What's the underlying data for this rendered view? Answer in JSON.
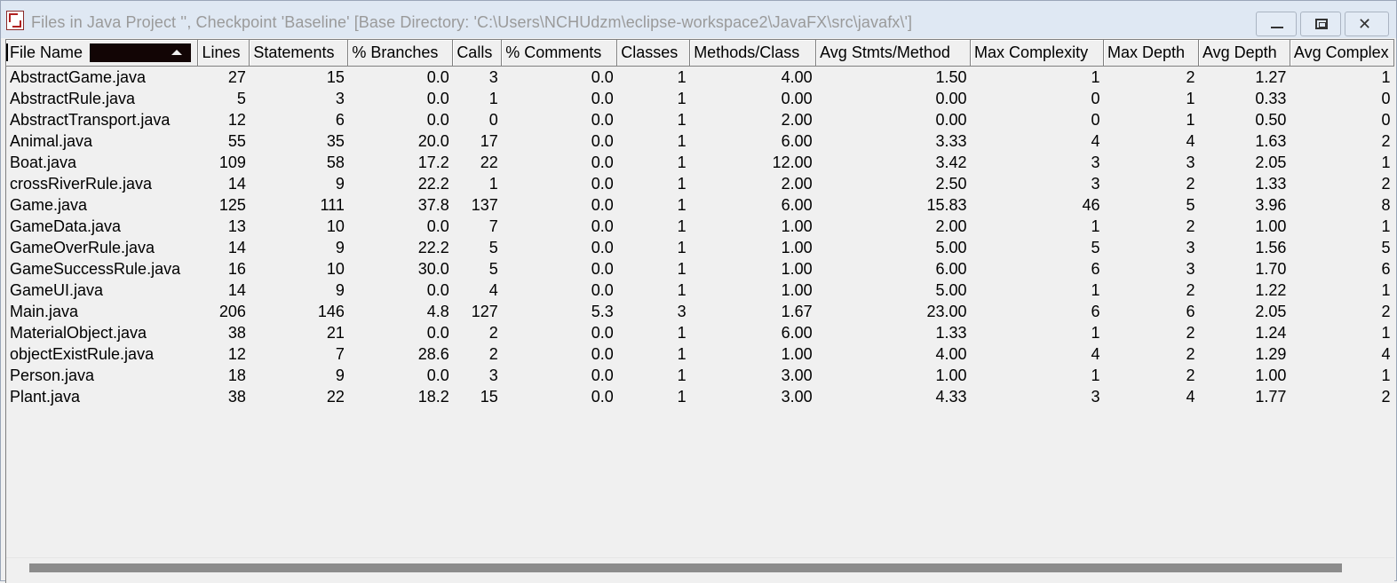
{
  "window": {
    "title": "Files in Java Project '', Checkpoint 'Baseline'  [Base Directory: 'C:\\Users\\NCHUdzm\\eclipse-workspace2\\JavaFX\\src\\javafx\\']",
    "icons": {
      "app": "sourcemonitor-app-icon",
      "minimize": "minimize-icon",
      "maximize": "maximize-icon",
      "close": "close-icon"
    },
    "close_glyph": "✕"
  },
  "table": {
    "sort_indicator": "sort-ascending-icon",
    "columns": [
      "File Name",
      "Lines",
      "Statements",
      "% Branches",
      "Calls",
      "% Comments",
      "Classes",
      "Methods/Class",
      "Avg Stmts/Method",
      "Max Complexity",
      "Max Depth",
      "Avg Depth",
      "Avg Complex"
    ],
    "rows": [
      [
        "AbstractGame.java",
        "27",
        "15",
        "0.0",
        "3",
        "0.0",
        "1",
        "4.00",
        "1.50",
        "1",
        "2",
        "1.27",
        "1"
      ],
      [
        "AbstractRule.java",
        "5",
        "3",
        "0.0",
        "1",
        "0.0",
        "1",
        "0.00",
        "0.00",
        "0",
        "1",
        "0.33",
        "0"
      ],
      [
        "AbstractTransport.java",
        "12",
        "6",
        "0.0",
        "0",
        "0.0",
        "1",
        "2.00",
        "0.00",
        "0",
        "1",
        "0.50",
        "0"
      ],
      [
        "Animal.java",
        "55",
        "35",
        "20.0",
        "17",
        "0.0",
        "1",
        "6.00",
        "3.33",
        "4",
        "4",
        "1.63",
        "2"
      ],
      [
        "Boat.java",
        "109",
        "58",
        "17.2",
        "22",
        "0.0",
        "1",
        "12.00",
        "3.42",
        "3",
        "3",
        "2.05",
        "1"
      ],
      [
        "crossRiverRule.java",
        "14",
        "9",
        "22.2",
        "1",
        "0.0",
        "1",
        "2.00",
        "2.50",
        "3",
        "2",
        "1.33",
        "2"
      ],
      [
        "Game.java",
        "125",
        "111",
        "37.8",
        "137",
        "0.0",
        "1",
        "6.00",
        "15.83",
        "46",
        "5",
        "3.96",
        "8"
      ],
      [
        "GameData.java",
        "13",
        "10",
        "0.0",
        "7",
        "0.0",
        "1",
        "1.00",
        "2.00",
        "1",
        "2",
        "1.00",
        "1"
      ],
      [
        "GameOverRule.java",
        "14",
        "9",
        "22.2",
        "5",
        "0.0",
        "1",
        "1.00",
        "5.00",
        "5",
        "3",
        "1.56",
        "5"
      ],
      [
        "GameSuccessRule.java",
        "16",
        "10",
        "30.0",
        "5",
        "0.0",
        "1",
        "1.00",
        "6.00",
        "6",
        "3",
        "1.70",
        "6"
      ],
      [
        "GameUI.java",
        "14",
        "9",
        "0.0",
        "4",
        "0.0",
        "1",
        "1.00",
        "5.00",
        "1",
        "2",
        "1.22",
        "1"
      ],
      [
        "Main.java",
        "206",
        "146",
        "4.8",
        "127",
        "5.3",
        "3",
        "1.67",
        "23.00",
        "6",
        "6",
        "2.05",
        "2"
      ],
      [
        "MaterialObject.java",
        "38",
        "21",
        "0.0",
        "2",
        "0.0",
        "1",
        "6.00",
        "1.33",
        "1",
        "2",
        "1.24",
        "1"
      ],
      [
        "objectExistRule.java",
        "12",
        "7",
        "28.6",
        "2",
        "0.0",
        "1",
        "1.00",
        "4.00",
        "4",
        "2",
        "1.29",
        "4"
      ],
      [
        "Person.java",
        "18",
        "9",
        "0.0",
        "3",
        "0.0",
        "1",
        "3.00",
        "1.00",
        "1",
        "2",
        "1.00",
        "1"
      ],
      [
        "Plant.java",
        "38",
        "22",
        "18.2",
        "15",
        "0.0",
        "1",
        "3.00",
        "4.33",
        "3",
        "4",
        "1.77",
        "2"
      ]
    ]
  }
}
